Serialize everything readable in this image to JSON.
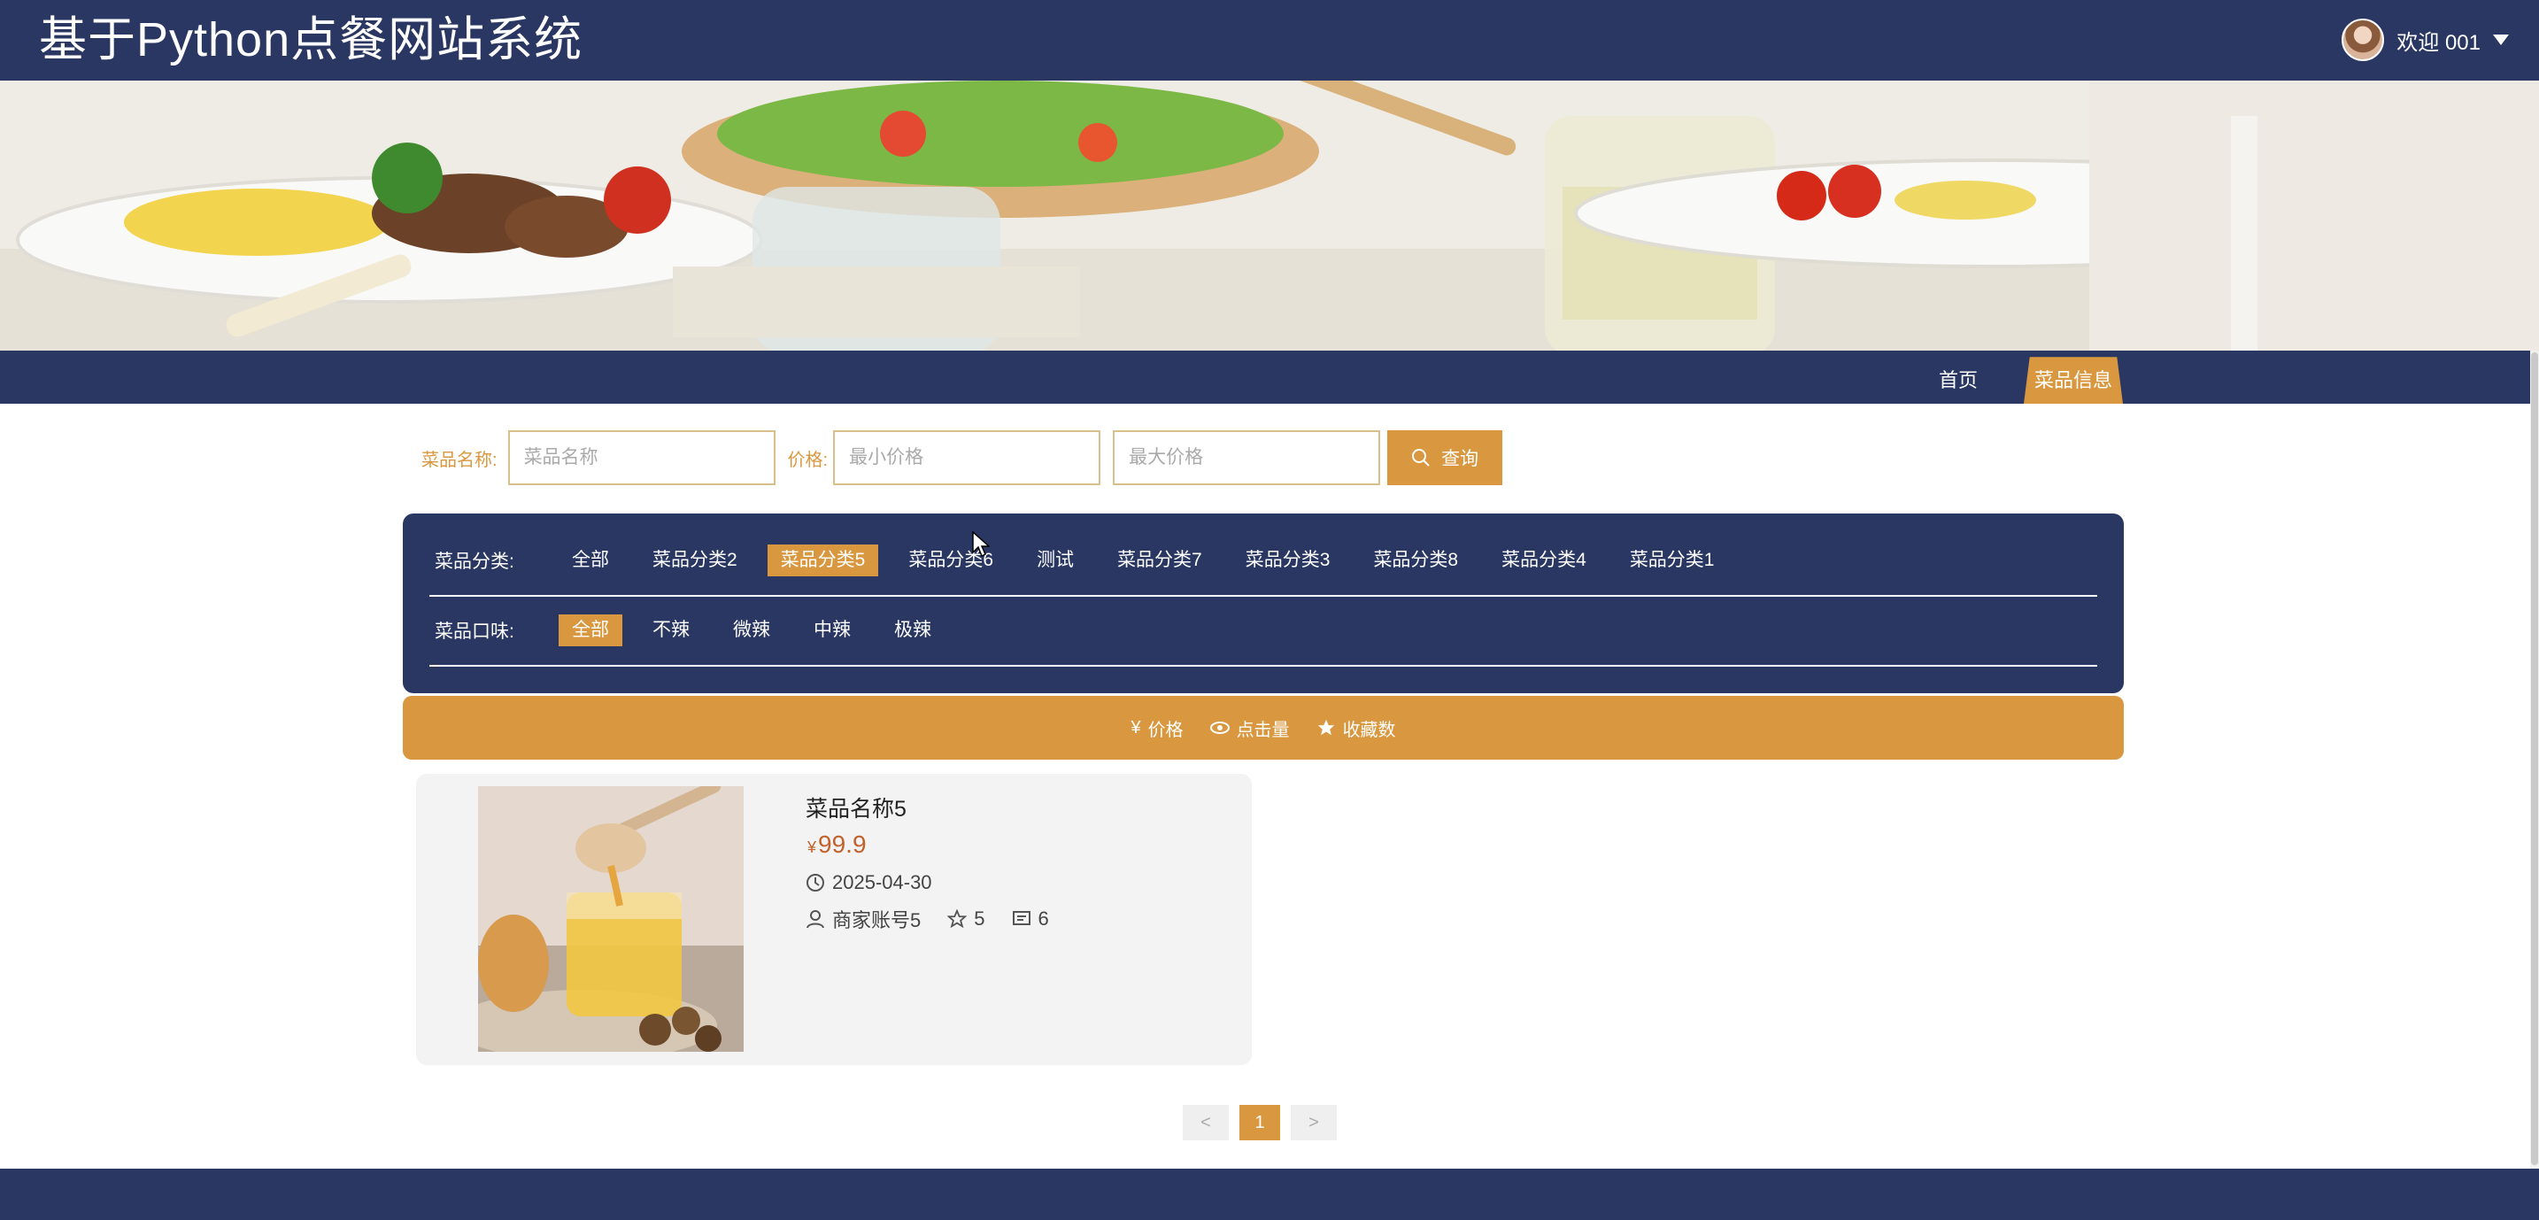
{
  "header": {
    "site_title": "基于Python点餐网站系统",
    "welcome": "欢迎 001"
  },
  "banner": {
    "slide_count": 3,
    "active_slide": 1
  },
  "nav": {
    "home": "首页",
    "food_info": "菜品信息"
  },
  "search": {
    "name_label": "菜品名称:",
    "name_placeholder": "菜品名称",
    "price_label": "价格:",
    "min_placeholder": "最小价格",
    "max_placeholder": "最大价格",
    "query_button": "查询"
  },
  "filters": {
    "category_label": "菜品分类:",
    "categories": [
      "全部",
      "菜品分类2",
      "菜品分类5",
      "菜品分类6",
      "测试",
      "菜品分类7",
      "菜品分类3",
      "菜品分类8",
      "菜品分类4",
      "菜品分类1"
    ],
    "category_active": 2,
    "flavor_label": "菜品口味:",
    "flavors": [
      "全部",
      "不辣",
      "微辣",
      "中辣",
      "极辣"
    ],
    "flavor_active": 0
  },
  "sort": {
    "price": "价格",
    "clicks": "点击量",
    "favorites": "收藏数"
  },
  "product": {
    "name": "菜品名称5",
    "currency": "¥",
    "price": "99.9",
    "date": "2025-04-30",
    "merchant": "商家账号5",
    "stars": "5",
    "comments": "6"
  },
  "pagination": {
    "prev": "<",
    "current": "1",
    "next": ">"
  },
  "colors": {
    "navy": "#293762",
    "accent": "#d9983f"
  },
  "icons": [
    "search-icon",
    "yen-icon",
    "eye-icon",
    "star-icon",
    "clock-icon",
    "user-icon",
    "star-outline-icon",
    "comment-icon",
    "caret-down-icon"
  ]
}
